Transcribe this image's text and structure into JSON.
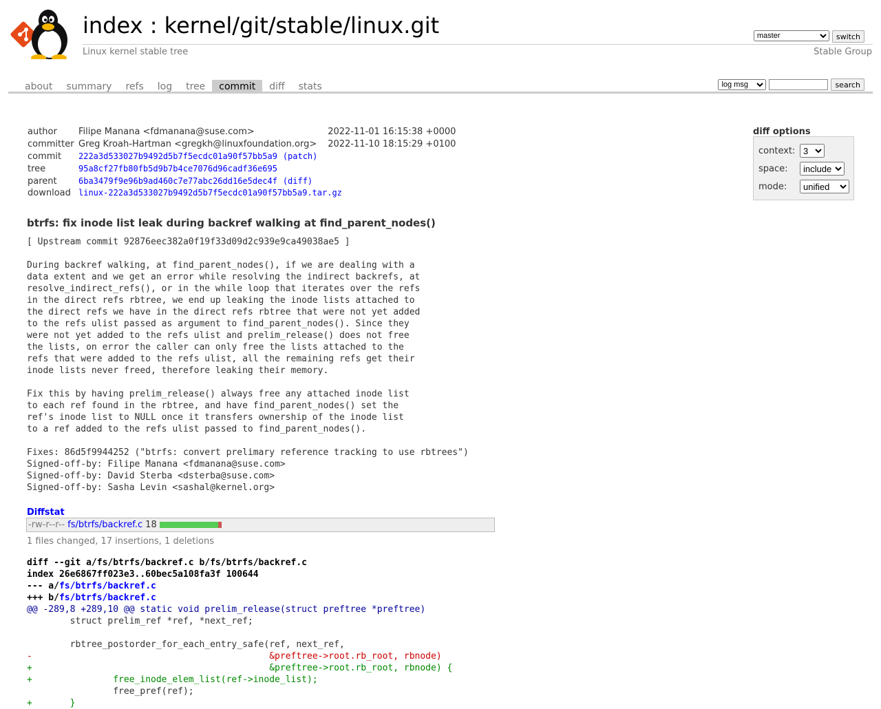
{
  "header": {
    "title_index": "index",
    "title_sep": " : ",
    "title_repo": "kernel/git/stable/linux.git",
    "subtitle": "Linux kernel stable tree",
    "owner": "Stable Group",
    "branch_selected": "master",
    "switch_label": "switch"
  },
  "tabs": [
    "about",
    "summary",
    "refs",
    "log",
    "tree",
    "commit",
    "diff",
    "stats"
  ],
  "active_tab": "commit",
  "search": {
    "type_selected": "log msg",
    "value": "",
    "button": "search"
  },
  "commit_info": {
    "author_label": "author",
    "author": "Filipe Manana <fdmanana@suse.com>",
    "author_date": "2022-11-01 16:15:38 +0000",
    "committer_label": "committer",
    "committer": "Greg Kroah-Hartman <gregkh@linuxfoundation.org>",
    "committer_date": "2022-11-10 18:15:29 +0100",
    "commit_label": "commit",
    "commit": "222a3d533027b9492d5b7f5ecdc01a90f57bb5a9",
    "commit_link": "(patch)",
    "tree_label": "tree",
    "tree": "95a8cf27fb80fb5d9b7b4ce7076d96cadf36e695",
    "parent_label": "parent",
    "parent": "6ba3479f9e96b9ad460c7e77abc26dd16e5dec4f",
    "parent_link": "(diff)",
    "download_label": "download",
    "download": "linux-222a3d533027b9492d5b7f5ecdc01a90f57bb5a9.tar.gz"
  },
  "diff_options": {
    "title": "diff options",
    "context_label": "context:",
    "context_value": "3",
    "space_label": "space:",
    "space_value": "include",
    "mode_label": "mode:",
    "mode_value": "unified"
  },
  "commit_subject": "btrfs: fix inode list leak during backref walking at find_parent_nodes()",
  "commit_message": "[ Upstream commit 92876eec382a0f19f33d09d2c939e9ca49038ae5 ]\n\nDuring backref walking, at find_parent_nodes(), if we are dealing with a\ndata extent and we get an error while resolving the indirect backrefs, at\nresolve_indirect_refs(), or in the while loop that iterates over the refs\nin the direct refs rbtree, we end up leaking the inode lists attached to\nthe direct refs we have in the direct refs rbtree that were not yet added\nto the refs ulist passed as argument to find_parent_nodes(). Since they\nwere not yet added to the refs ulist and prelim_release() does not free\nthe lists, on error the caller can only free the lists attached to the\nrefs that were added to the refs ulist, all the remaining refs get their\ninode lists never freed, therefore leaking their memory.\n\nFix this by having prelim_release() always free any attached inode list\nto each ref found in the rbtree, and have find_parent_nodes() set the\nref's inode list to NULL once it transfers ownership of the inode list\nto a ref added to the refs ulist passed to find_parent_nodes().\n\nFixes: 86d5f9944252 (\"btrfs: convert prelimary reference tracking to use rbtrees\")\nSigned-off-by: Filipe Manana <fdmanana@suse.com>\nSigned-off-by: David Sterba <dsterba@suse.com>\nSigned-off-by: Sasha Levin <sashal@kernel.org>",
  "diffstat": {
    "header": "Diffstat",
    "mode": "-rw-r--r--",
    "file": "fs/btrfs/backref.c",
    "changes": "18",
    "insertions": 17,
    "deletions": 1,
    "summary": "1 files changed, 17 insertions, 1 deletions"
  },
  "diff": {
    "line1": "diff --git a/fs/btrfs/backref.c b/fs/btrfs/backref.c",
    "line2": "index 26e6867ff023e3..60bec5a108fa3f 100644",
    "minus_prefix": "--- a/",
    "minus_file": "fs/btrfs/backref.c",
    "plus_prefix": "+++ b/",
    "plus_file": "fs/btrfs/backref.c",
    "hunk": "@@ -289,8 +289,10 @@ static void prelim_release(struct preftree *preftree)",
    "lines": [
      {
        "type": "ctx",
        "text": " \tstruct prelim_ref *ref, *next_ref;"
      },
      {
        "type": "ctx",
        "text": " "
      },
      {
        "type": "ctx",
        "text": " \trbtree_postorder_for_each_entry_safe(ref, next_ref,"
      },
      {
        "type": "del",
        "text": "-\t\t\t\t\t     &preftree->root.rb_root, rbnode)"
      },
      {
        "type": "add",
        "text": "+\t\t\t\t\t     &preftree->root.rb_root, rbnode) {"
      },
      {
        "type": "add",
        "text": "+\t\tfree_inode_elem_list(ref->inode_list);"
      },
      {
        "type": "ctx",
        "text": " \t\tfree_pref(ref);"
      },
      {
        "type": "add",
        "text": "+\t}"
      }
    ]
  },
  "colors": {
    "link": "#0000ff",
    "add": "#008800",
    "del": "#cc0000",
    "hunk": "#000099",
    "tab_active_bg": "#cccccc"
  },
  "icons": {
    "logo": "cgit-tux-logo"
  }
}
